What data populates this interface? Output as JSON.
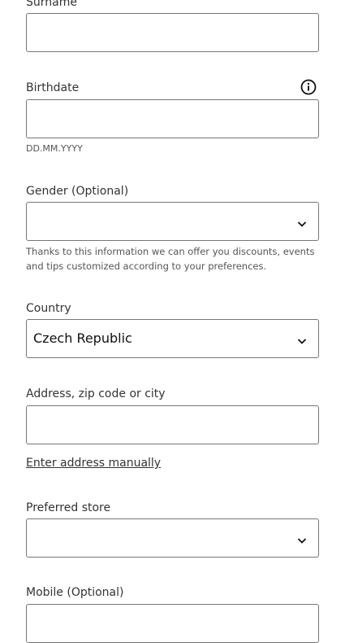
{
  "form": {
    "surname": {
      "label": "Surname",
      "value": ""
    },
    "birthdate": {
      "label": "Birthdate",
      "value": "",
      "hint": "DD.MM.YYYY",
      "info_icon": "info-icon"
    },
    "gender": {
      "label": "Gender (Optional)",
      "value": "",
      "helper": "Thanks to this information we can offer you discounts, events and tips customized according to your preferences."
    },
    "country": {
      "label": "Country",
      "value": "Czech Republic"
    },
    "address": {
      "label": "Address, zip code or city",
      "value": "",
      "manual_link": "Enter address manually"
    },
    "preferred_store": {
      "label": "Preferred store",
      "value": ""
    },
    "mobile": {
      "label": "Mobile (Optional)",
      "value": ""
    }
  },
  "icons": {
    "dropdown": "chevron-down-icon",
    "info": "info-icon"
  }
}
